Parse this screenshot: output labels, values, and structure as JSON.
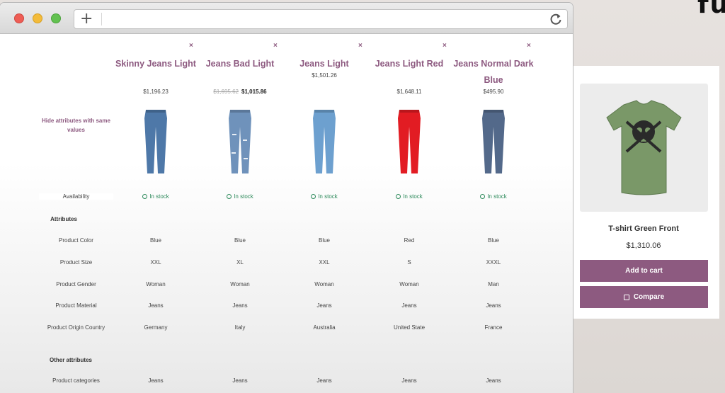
{
  "corner_text": "fu",
  "browser": {
    "newtab_glyph": "+",
    "address_value": ""
  },
  "compare": {
    "hide_attributes_label": "Hide attributes with same values",
    "remove_glyph": "×",
    "products": [
      {
        "name": "Skinny Jeans Light",
        "price": "$1,196.23",
        "old_price": "",
        "stock": "In stock",
        "color": "Blue",
        "size": "XXL",
        "gender": "Woman",
        "material": "Jeans",
        "country": "Germany",
        "categories": "Jeans",
        "pants_color": "#4e78a8"
      },
      {
        "name": "Jeans Bad Light",
        "price": "$1,015.86",
        "old_price": "$1,695.62",
        "stock": "In stock",
        "color": "Blue",
        "size": "XL",
        "gender": "Woman",
        "material": "Jeans",
        "country": "Italy",
        "categories": "Jeans",
        "pants_color": "#6f92bb"
      },
      {
        "name": "Jeans Light",
        "price": "$1,501.26",
        "old_price": "",
        "stock": "In stock",
        "color": "Blue",
        "size": "XXL",
        "gender": "Woman",
        "material": "Jeans",
        "country": "Australia",
        "categories": "Jeans",
        "pants_color": "#6da0cf"
      },
      {
        "name": "Jeans Light Red",
        "price": "$1,648.11",
        "old_price": "",
        "stock": "In stock",
        "color": "Red",
        "size": "S",
        "gender": "Woman",
        "material": "Jeans",
        "country": "United State",
        "categories": "Jeans",
        "pants_color": "#e21c23"
      },
      {
        "name": "Jeans Normal Dark Blue",
        "price": "$495.90",
        "old_price": "",
        "stock": "In stock",
        "color": "Blue",
        "size": "XXXL",
        "gender": "Man",
        "material": "Jeans",
        "country": "France",
        "categories": "Jeans",
        "pants_color": "#53698a"
      }
    ],
    "rows": {
      "availability": "Availability",
      "attributes": "Attributes",
      "product_color": "Product Color",
      "product_size": "Product Size",
      "product_gender": "Product Gender",
      "product_material": "Product Material",
      "product_origin_country": "Product Origin Country",
      "other_attributes": "Other attributes",
      "product_categories": "Product categories"
    }
  },
  "product_card": {
    "name": "T-shirt Green Front",
    "price": "$1,310.06",
    "add_to_cart_label": "Add to cart",
    "compare_label": "Compare",
    "shirt_color": "#7a9868"
  },
  "colors": {
    "accent": "#8d5a80",
    "in_stock": "#2d8a5b"
  }
}
